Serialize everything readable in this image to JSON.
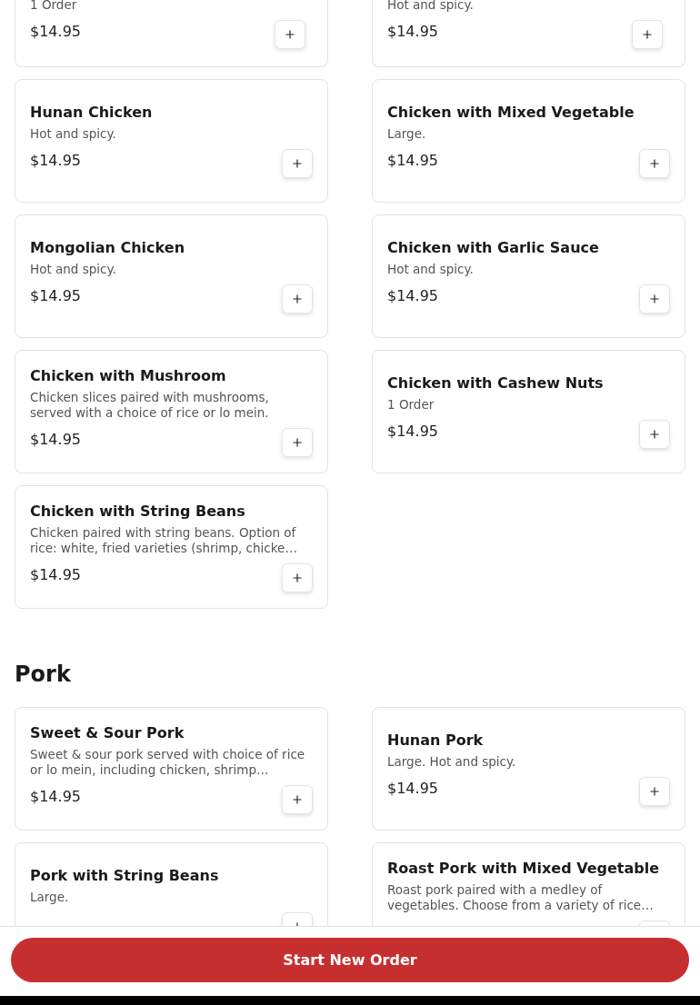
{
  "sections": [
    {
      "items": [
        {
          "description": "1 Order",
          "price": "$14.95"
        },
        {
          "description": "Hot and spicy.",
          "price": "$14.95"
        },
        {
          "title": "Hunan Chicken",
          "description": "Hot and spicy.",
          "price": "$14.95"
        },
        {
          "title": "Chicken with Mixed Vegetable",
          "description": "Large.",
          "price": "$14.95"
        },
        {
          "title": "Mongolian Chicken",
          "description": "Hot and spicy.",
          "price": "$14.95"
        },
        {
          "title": "Chicken with Garlic Sauce",
          "description": "Hot and spicy.",
          "price": "$14.95"
        },
        {
          "title": "Chicken with Mushroom",
          "description": "Chicken slices paired with mushrooms, served with a choice of rice or lo mein.",
          "price": "$14.95"
        },
        {
          "title": "Chicken with Cashew Nuts",
          "description": "1 Order",
          "price": "$14.95"
        },
        {
          "title": "Chicken with String Beans",
          "description": "Chicken paired with string beans. Option of rice: white, fried varieties (shrimp, chicke…",
          "price": "$14.95"
        }
      ]
    },
    {
      "heading": "Pork",
      "items": [
        {
          "title": "Sweet & Sour Pork",
          "description": "Sweet & sour pork served with choice of rice or lo mein, including chicken, shrimp…",
          "price": "$14.95"
        },
        {
          "title": "Hunan Pork",
          "description": "Large. Hot and spicy.",
          "price": "$14.95"
        },
        {
          "title": "Pork with String Beans",
          "description": "Large."
        },
        {
          "title": "Roast Pork with Mixed Vegetable",
          "description": "Roast pork paired with a medley of vegetables. Choose from a variety of rice…"
        }
      ]
    }
  ],
  "footer": {
    "button": "Start New Order"
  }
}
